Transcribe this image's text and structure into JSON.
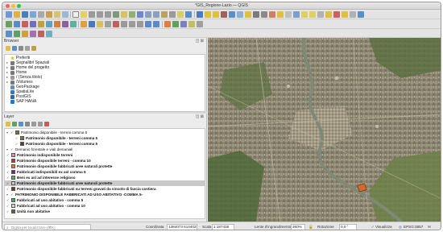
{
  "window": {
    "title": "*GIS_Regione-Lazio — QGIS"
  },
  "browser": {
    "title": "Browser",
    "items": [
      {
        "label": "Preferiti",
        "icon": "star-icon",
        "color": "#e8b400"
      },
      {
        "label": "Segnalibri Spaziali",
        "icon": "folder-icon",
        "color": "#7a7a7a"
      },
      {
        "label": "Home del progetto",
        "icon": "folder-icon",
        "color": "#7a7a7a"
      },
      {
        "label": "Home",
        "icon": "folder-icon",
        "color": "#7a7a7a"
      },
      {
        "label": "/ (Senza titolo)",
        "icon": "drive-icon",
        "color": "#9a9a9a"
      },
      {
        "label": "/Volumes",
        "icon": "folder-icon",
        "color": "#7a7a7a"
      },
      {
        "label": "GeoPackage",
        "icon": "geopackage-icon",
        "color": "#5a8fc8"
      },
      {
        "label": "SpatiaLite",
        "icon": "spatialite-icon",
        "color": "#3a78b8"
      },
      {
        "label": "PostGIS",
        "icon": "postgis-icon",
        "color": "#336699"
      },
      {
        "label": "SAP HANA",
        "icon": "sap-hana-icon",
        "color": "#1f7ad1"
      }
    ]
  },
  "layers": {
    "title": "Layer",
    "items": [
      {
        "label": "Patrimonio disponibile - terreni comma 5",
        "swatch": null,
        "group": true
      },
      {
        "label": "Patrimonio disponibile - terreni comma 5",
        "swatch": "#8a6a45"
      },
      {
        "label": "Patrimonio disponibile - terreni comma 5",
        "swatch": "#6b3b22"
      },
      {
        "label": "Demanio forestale e viali demaniali",
        "swatch": null,
        "group": true
      },
      {
        "label": "Patrimonio indisponibile terreni",
        "swatch": "#f08aa8"
      },
      {
        "label": "Patrimonio disponibile terreni - comma 10",
        "swatch": "#d92b2b"
      },
      {
        "label": "Patrimonio disponibile fabbricati aree naturali protette",
        "swatch": "#ee7a1e"
      },
      {
        "label": "Fabbricati indisponibili ex asl comma 5",
        "swatch": "#8e1a8e"
      },
      {
        "label": "Beni ex asl ad interesse religioso",
        "swatch": "#55b24a"
      },
      {
        "label": "Patrimonio disponibile fabbricati aree naturali protette",
        "swatch": "#c9c9c9"
      },
      {
        "label": "Patrimonio disponibile fabbricati su terreni gravati da vincolo di fascia costiera",
        "swatch": "#7a3a1a"
      },
      {
        "label": "PATRIMONIO DISPONIBILE FABBRICATI AD USO ABITATIVO -COMMA 5-",
        "swatch": null
      },
      {
        "label": "Fabbricati ad uso abitativo - comma 5",
        "swatch": "#37b24a"
      },
      {
        "label": "Fabbricati ad uso abitativo - comma 10",
        "swatch": "#d8d8d8"
      },
      {
        "label": "Unità non abitative",
        "swatch": "#3d7a2d"
      }
    ]
  },
  "status": {
    "locator_placeholder": "Digita per localizzare (⌘K)",
    "coordinate_label": "Coordinata",
    "coordinate_value": "1384073 5144029",
    "scale_label": "Scala",
    "scale_value": "1:187438",
    "magnifier_label": "Lente d'ingrandimento",
    "magnifier_value": "360%",
    "rotation_label": "Rotazione",
    "rotation_value": "0,0 °",
    "render_label": "Visualizza",
    "crs_label": "EPSG:3857"
  },
  "colors": {
    "selection": "#c9c9c9",
    "map_base": "#6d7358",
    "river": "#7f8a76"
  }
}
